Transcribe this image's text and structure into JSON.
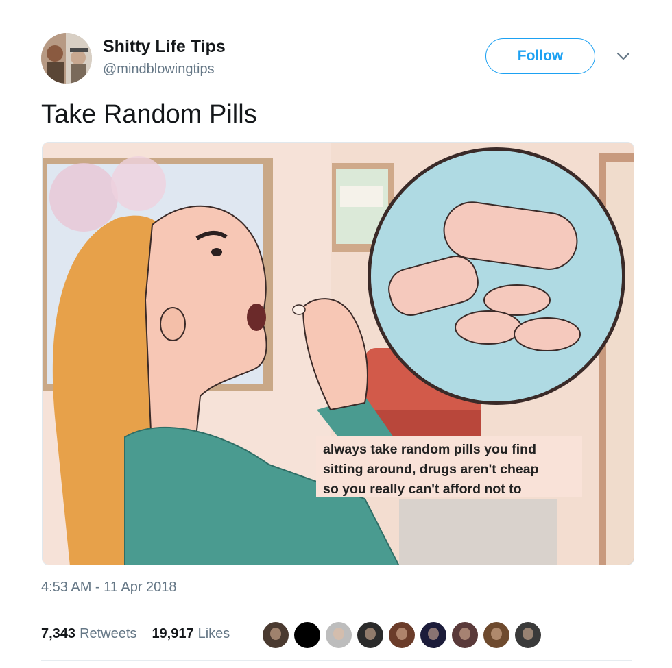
{
  "tweet": {
    "author_name": "Shitty Life Tips",
    "author_handle": "@mindblowingtips",
    "follow_label": "Follow",
    "text": "Take Random Pills",
    "image_caption": "always take random pills you find\nsitting around, drugs aren't cheap\nso you really can't afford not to",
    "timestamp": "4:53 AM - 11 Apr 2018",
    "retweets_count": "7,343",
    "retweets_label": "Retweets",
    "likes_count": "19,917",
    "likes_label": "Likes"
  },
  "likers": [
    {
      "avatar": "avatar-1",
      "color": "#4a3a30"
    },
    {
      "avatar": "avatar-2",
      "color": "#000000"
    },
    {
      "avatar": "avatar-3",
      "color": "#bdbdbd"
    },
    {
      "avatar": "avatar-4",
      "color": "#2b2b2b"
    },
    {
      "avatar": "avatar-5",
      "color": "#6b3c2a"
    },
    {
      "avatar": "avatar-6",
      "color": "#1c1c3a"
    },
    {
      "avatar": "avatar-7",
      "color": "#5a3a3a"
    },
    {
      "avatar": "avatar-8",
      "color": "#6e4a2e"
    },
    {
      "avatar": "avatar-9",
      "color": "#3a3a3a"
    }
  ],
  "colors": {
    "accent": "#1da1f2",
    "secondary_text": "#657786",
    "primary_text": "#14171a"
  },
  "icons": {
    "more": "chevron-down-icon"
  }
}
